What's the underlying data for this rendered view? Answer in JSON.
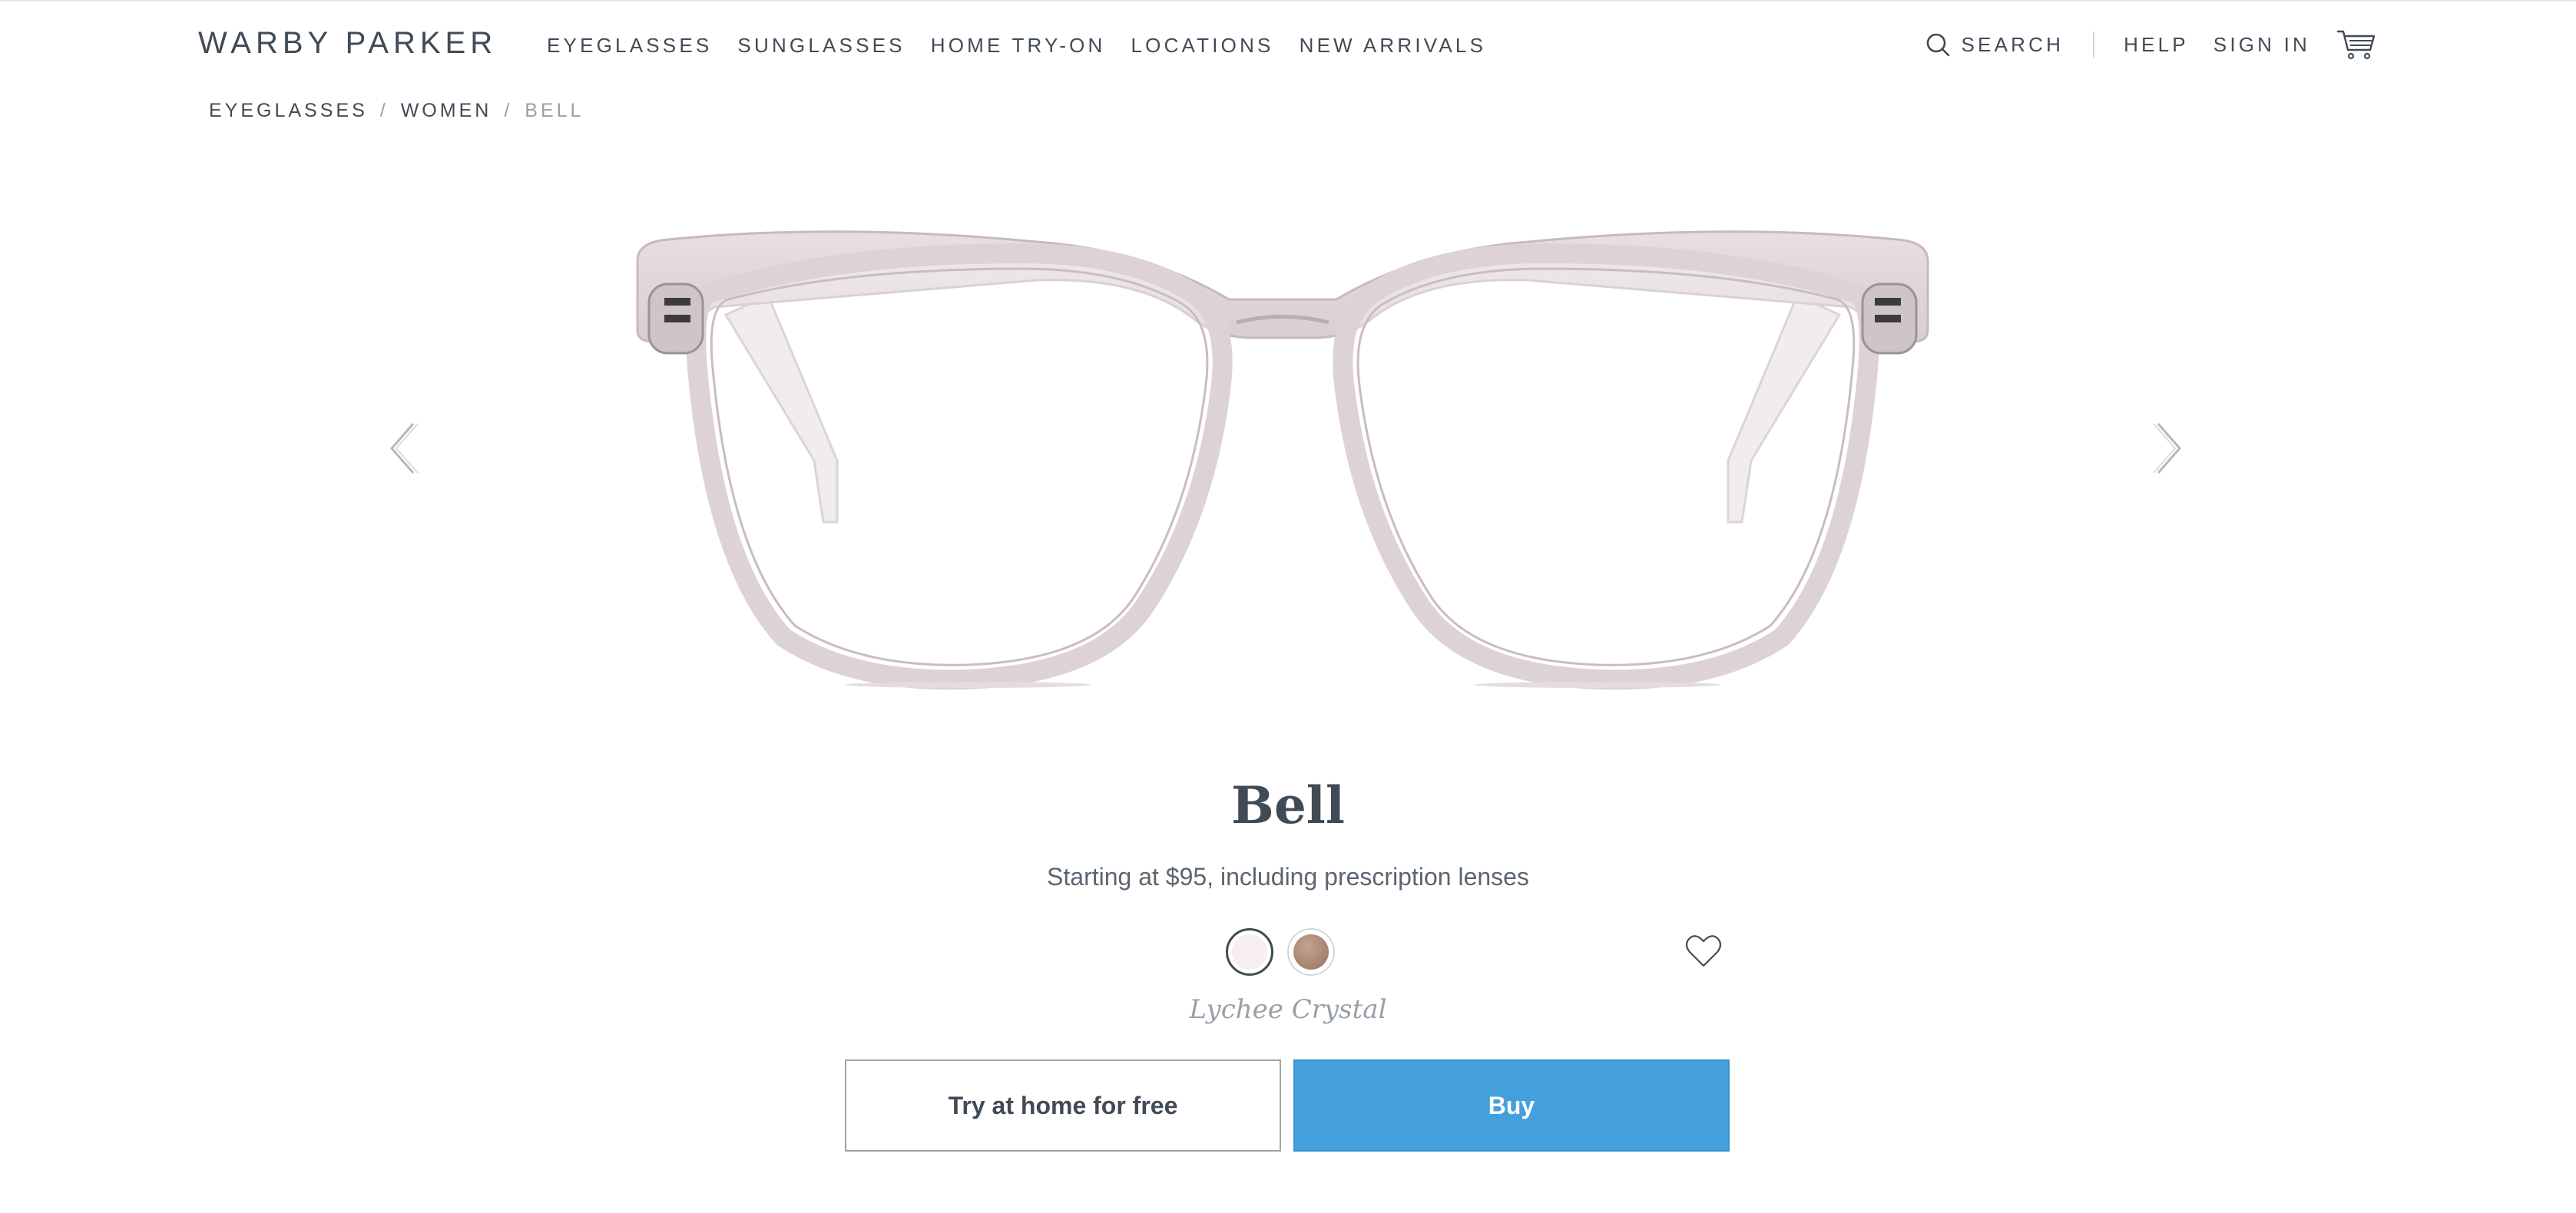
{
  "header": {
    "logo": "WARBY PARKER",
    "nav": [
      "EYEGLASSES",
      "SUNGLASSES",
      "HOME TRY-ON",
      "LOCATIONS",
      "NEW ARRIVALS"
    ],
    "search_label": "SEARCH",
    "help_label": "HELP",
    "signin_label": "SIGN IN",
    "search_icon": "search-icon",
    "cart_icon": "cart-icon"
  },
  "breadcrumb": {
    "items": [
      "EYEGLASSES",
      "WOMEN"
    ],
    "separator": "/",
    "current": "BELL"
  },
  "product": {
    "name": "Bell",
    "price_text": "Starting at $95, including prescription lenses",
    "selected_color": "Lychee Crystal",
    "swatches": [
      {
        "color": "#f6eef0",
        "selected": true
      },
      {
        "color": "#a88672",
        "selected": false
      }
    ],
    "image": "eyeglasses-front-view",
    "favorite_icon": "heart-icon",
    "prev_icon": "chevron-left-icon",
    "next_icon": "chevron-right-icon"
  },
  "actions": {
    "try_label": "Try at home for free",
    "buy_label": "Buy"
  },
  "colors": {
    "text": "#414b56",
    "muted": "#98a0a8",
    "accent": "#43a0dd"
  }
}
